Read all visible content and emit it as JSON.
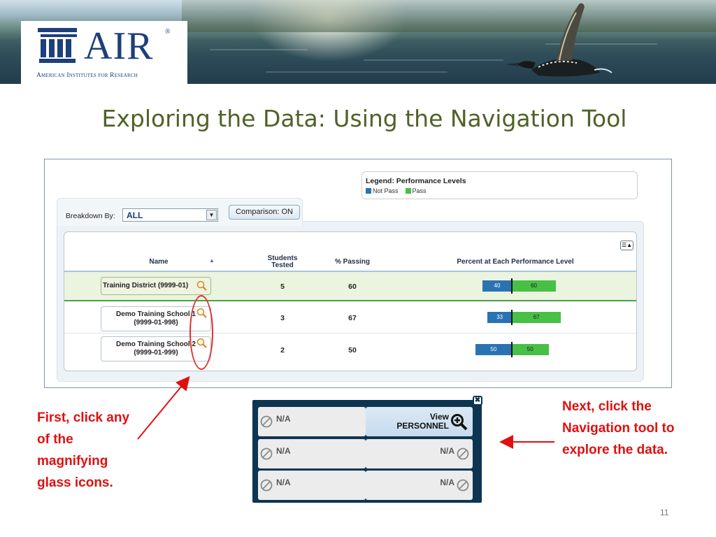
{
  "banner": {
    "logo_text": "AIR",
    "logo_registered": "®",
    "logo_subtitle": "American Institutes for Research"
  },
  "slide": {
    "title": "Exploring the Data: Using the Navigation Tool",
    "number": "11"
  },
  "app": {
    "legend": {
      "title": "Legend: Performance Levels",
      "items": [
        {
          "label": "Not Pass",
          "color": "#2a73b3"
        },
        {
          "label": "Pass",
          "color": "#47c045"
        }
      ]
    },
    "breakdown": {
      "label": "Breakdown By:",
      "selected": "ALL"
    },
    "comparison_button": "Comparison: ON",
    "table": {
      "columns": {
        "name": "Name",
        "students_tested": "Students Tested",
        "percent_passing": "% Passing",
        "performance": "Percent at Each Performance Level"
      },
      "rows": [
        {
          "name_line1": "Training District (9999-01)",
          "name_line2": "",
          "students_tested": "5",
          "percent_passing": "60",
          "not_pass": 40,
          "pass": 60
        },
        {
          "name_line1": "Demo Training School 1",
          "name_line2": "(9999-01-998)",
          "students_tested": "3",
          "percent_passing": "67",
          "not_pass": 33,
          "pass": 67
        },
        {
          "name_line1": "Demo Training School 2",
          "name_line2": "(9999-01-999)",
          "students_tested": "2",
          "percent_passing": "50",
          "not_pass": 50,
          "pass": 50
        }
      ]
    }
  },
  "annotations": {
    "left_note": "First, click any of the magnifying glass icons.",
    "right_note": "Next, click the Navigation tool to explore the data."
  },
  "navigation_tool": {
    "rows": [
      {
        "left": "N/A",
        "right": "View PERSONNEL",
        "right_line1": "View",
        "right_line2": "PERSONNEL"
      },
      {
        "left": "N/A",
        "right": "N/A"
      },
      {
        "left": "N/A",
        "right": "N/A"
      }
    ]
  }
}
